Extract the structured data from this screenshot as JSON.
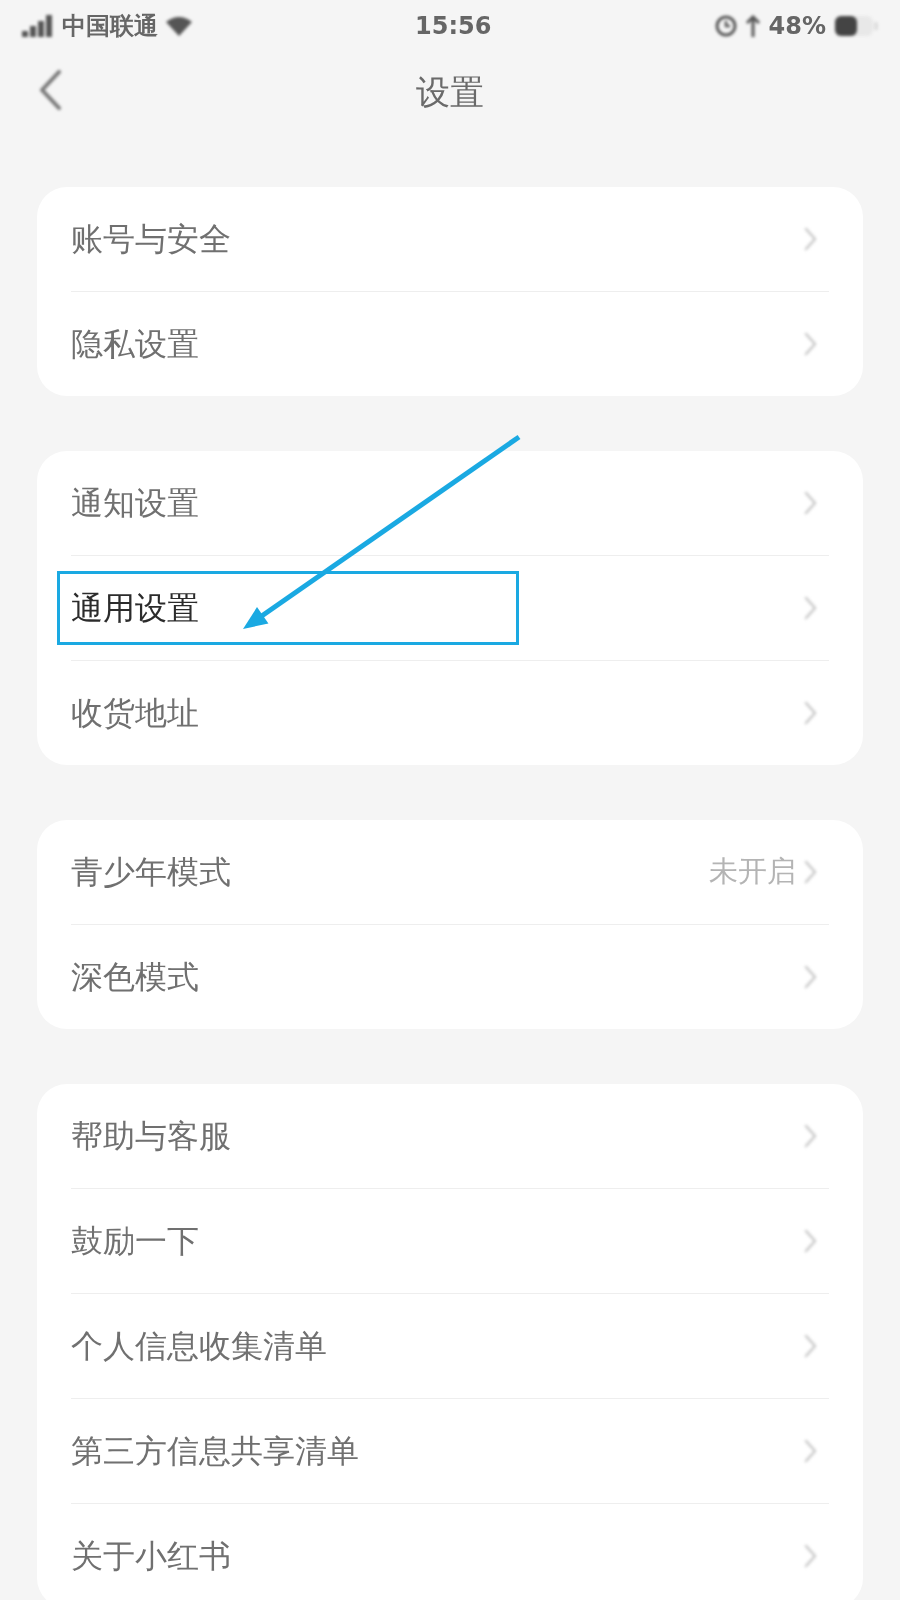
{
  "status_bar": {
    "carrier": "中国联通",
    "time": "15:56",
    "battery": "48%"
  },
  "header": {
    "title": "设置"
  },
  "groups": [
    {
      "items": [
        {
          "label": "账号与安全",
          "highlighted": false
        },
        {
          "label": "隐私设置",
          "highlighted": false
        }
      ]
    },
    {
      "items": [
        {
          "label": "通知设置",
          "highlighted": false
        },
        {
          "label": "通用设置",
          "highlighted": true
        },
        {
          "label": "收货地址",
          "highlighted": false
        }
      ]
    },
    {
      "items": [
        {
          "label": "青少年模式",
          "value": "未开启",
          "highlighted": false
        },
        {
          "label": "深色模式",
          "highlighted": false
        }
      ]
    },
    {
      "items": [
        {
          "label": "帮助与客服",
          "highlighted": false
        },
        {
          "label": "鼓励一下",
          "highlighted": false
        },
        {
          "label": "个人信息收集清单",
          "highlighted": false
        },
        {
          "label": "第三方信息共享清单",
          "highlighted": false
        },
        {
          "label": "关于小红书",
          "highlighted": false
        }
      ]
    }
  ]
}
